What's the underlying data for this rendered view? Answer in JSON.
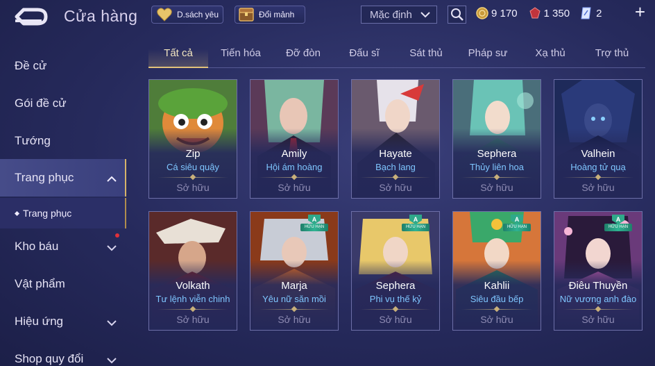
{
  "header": {
    "title": "Cửa hàng",
    "wishlist_label": "D.sách yêu",
    "exchange_label": "Đổi mảnh",
    "sort_value": "Mặc định",
    "currencies": [
      {
        "icon": "gold-coin-icon",
        "value": "9 170"
      },
      {
        "icon": "red-gem-icon",
        "value": "1 350"
      },
      {
        "icon": "ticket-icon",
        "value": "2"
      }
    ]
  },
  "sidebar": {
    "items": [
      {
        "label": "Đề cử"
      },
      {
        "label": "Gói đề cử"
      },
      {
        "label": "Tướng"
      },
      {
        "label": "Trang phục"
      },
      {
        "label": "Kho báu"
      },
      {
        "label": "Vật phẩm"
      },
      {
        "label": "Hiệu ứng"
      },
      {
        "label": "Shop quy đổi"
      }
    ],
    "sub_item": "Trang phục"
  },
  "tabs": [
    "Tất cả",
    "Tiến hóa",
    "Đỡ đòn",
    "Đấu sĩ",
    "Sát thủ",
    "Pháp sư",
    "Xạ thủ",
    "Trợ thủ"
  ],
  "badge": {
    "grade": "A",
    "text": "HỮU HẠN"
  },
  "cards": [
    {
      "name": "Zip",
      "skin": "Cá siêu quậy",
      "status": "Sở hữu"
    },
    {
      "name": "Amily",
      "skin": "Hội ám hoàng",
      "status": "Sở hữu"
    },
    {
      "name": "Hayate",
      "skin": "Bạch lang",
      "status": "Sở hữu"
    },
    {
      "name": "Sephera",
      "skin": "Thủy liên hoa",
      "status": "Sở hữu"
    },
    {
      "name": "Valhein",
      "skin": "Hoàng tử quạ",
      "status": "Sở hữu"
    },
    {
      "name": "Volkath",
      "skin": "Tư lệnh viễn chinh",
      "status": "Sở hữu"
    },
    {
      "name": "Marja",
      "skin": "Yêu nữ săn mồi",
      "status": "Sở hữu"
    },
    {
      "name": "Sephera",
      "skin": "Phi vụ thế kỷ",
      "status": "Sở hữu"
    },
    {
      "name": "Kahlii",
      "skin": "Siêu đầu bếp",
      "status": "Sở hữu"
    },
    {
      "name": "Điêu Thuyền",
      "skin": "Nữ vương anh đào",
      "status": "Sở hữu"
    }
  ]
}
